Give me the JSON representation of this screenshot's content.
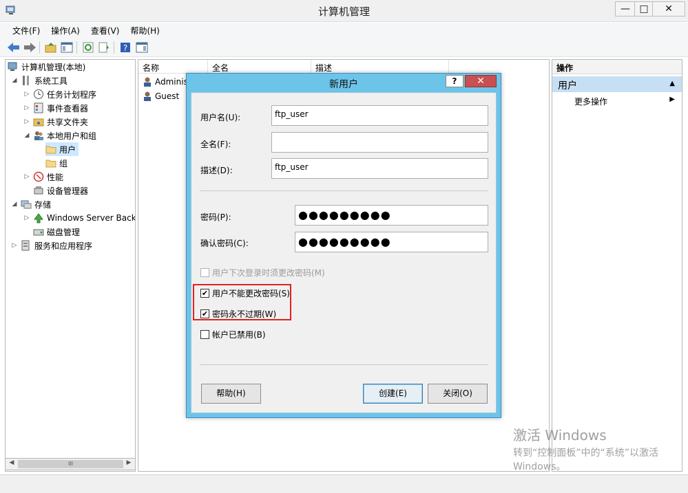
{
  "window": {
    "title": "计算机管理",
    "min": "—",
    "max": "□",
    "close": "✕"
  },
  "menu": [
    "文件(F)",
    "操作(A)",
    "查看(V)",
    "帮助(H)"
  ],
  "tree": {
    "root": "计算机管理(本地)",
    "system_tools": "系统工具",
    "task_scheduler": "任务计划程序",
    "event_viewer": "事件查看器",
    "shared_folders": "共享文件夹",
    "local_users_groups": "本地用户和组",
    "users": "用户",
    "groups": "组",
    "performance": "性能",
    "device_manager": "设备管理器",
    "storage": "存储",
    "windows_backup": "Windows Server Back",
    "disk_management": "磁盘管理",
    "services_apps": "服务和应用程序",
    "scroll_thumb": "III"
  },
  "list": {
    "columns": [
      "名称",
      "全名",
      "描述"
    ],
    "rows": [
      "Administ",
      "Guest"
    ]
  },
  "actions": {
    "header": "操作",
    "section": "用户",
    "more": "更多操作"
  },
  "dialog": {
    "title": "新用户",
    "help_icon": "?",
    "close_icon": "✕",
    "username_label": "用户名(U):",
    "username_value": "ftp_user",
    "fullname_label": "全名(F):",
    "fullname_value": "",
    "desc_label": "描述(D):",
    "desc_value": "ftp_user",
    "password_label": "密码(P):",
    "password_value": "●●●●●●●●●",
    "confirm_label": "确认密码(C):",
    "confirm_value": "●●●●●●●●●",
    "chk_must_change": "用户下次登录时须更改密码(M)",
    "chk_cannot_change": "用户不能更改密码(S)",
    "chk_never_expires": "密码永不过期(W)",
    "chk_disabled": "帐户已禁用(B)",
    "btn_help": "帮助(H)",
    "btn_create": "创建(E)",
    "btn_close": "关闭(O)",
    "checkmark": "✔"
  },
  "watermark": {
    "line1": "激活 Windows",
    "line2": "转到“控制面板”中的“系统”以激活",
    "line3": "Windows。"
  }
}
